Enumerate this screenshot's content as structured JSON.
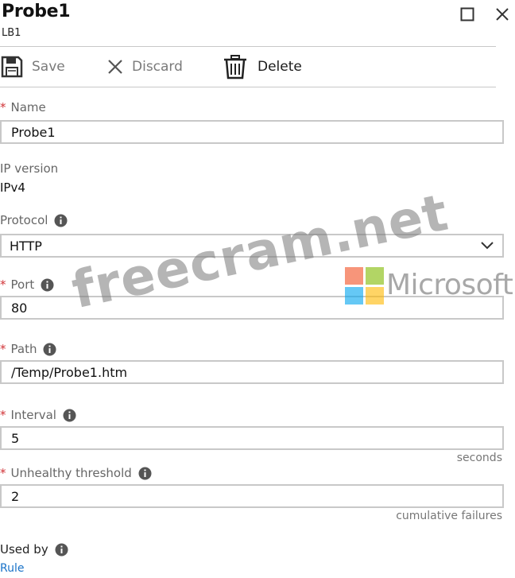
{
  "blade": {
    "title": "Probe1",
    "subtitle": "LB1"
  },
  "toolbar": {
    "save_label": "Save",
    "discard_label": "Discard",
    "delete_label": "Delete"
  },
  "form": {
    "name": {
      "label": "Name",
      "value": "Probe1"
    },
    "ip_version": {
      "label": "IP version",
      "value": "IPv4"
    },
    "protocol": {
      "label": "Protocol",
      "value": "HTTP"
    },
    "port": {
      "label": "Port",
      "value": "80"
    },
    "path": {
      "label": "Path",
      "value": "/Temp/Probe1.htm"
    },
    "interval": {
      "label": "Interval",
      "value": "5",
      "unit": "seconds"
    },
    "unhealthy_threshold": {
      "label": "Unhealthy threshold",
      "value": "2",
      "unit": "cumulative failures"
    },
    "used_by": {
      "label": "Used by",
      "link": "Rule"
    }
  },
  "watermark": {
    "site": "freecram.net",
    "brand": "Microsoft"
  },
  "colors": {
    "required_asterisk": "#d13438",
    "link": "#1a73c8",
    "input_border": "#c8c8c8"
  },
  "icons": {
    "maximize": "maximize-icon",
    "close": "close-icon",
    "save": "save-icon",
    "discard": "discard-icon",
    "delete": "trash-icon",
    "info": "info-icon",
    "dropdown": "chevron-down-icon"
  }
}
